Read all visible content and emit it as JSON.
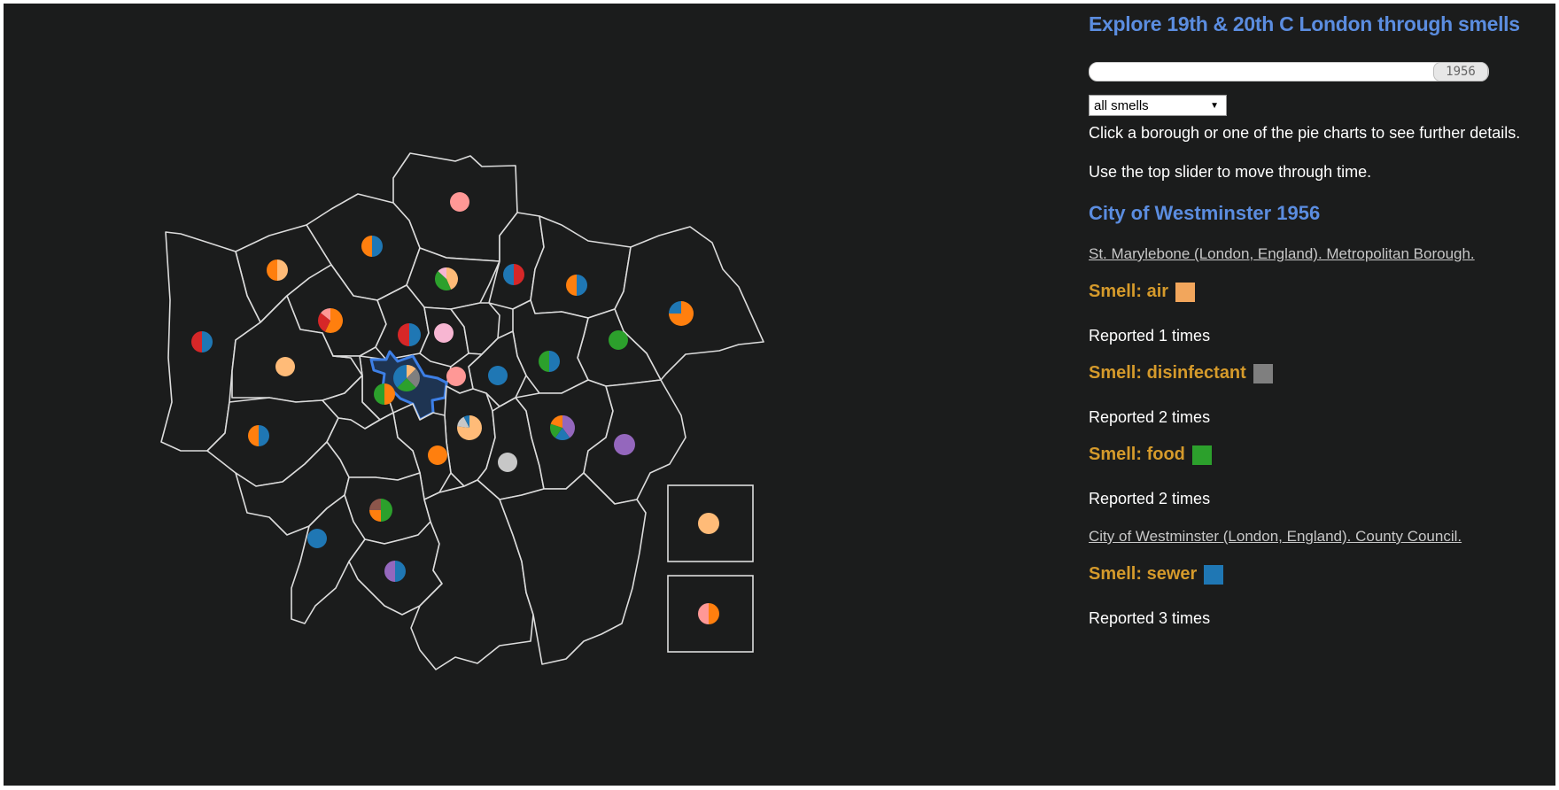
{
  "title": "Explore 19th & 20th C London through smells",
  "slider": {
    "value": "1956",
    "position": 1.0
  },
  "filter": {
    "selected": "all smells"
  },
  "instructions": [
    "Click a borough or one of the pie charts to see further details.",
    "Use the top slider to move through time."
  ],
  "details": {
    "heading": "City of Westminster 1956",
    "sources": [
      {
        "name": "St. Marylebone (London, England). Metropolitan Borough.",
        "smells": [
          {
            "label": "Smell: air",
            "color": "#f2a65c",
            "reported": "Reported 1 times"
          },
          {
            "label": "Smell: disinfectant",
            "color": "#7f7f7f",
            "reported": "Reported 2 times"
          },
          {
            "label": "Smell: food",
            "color": "#2ca02c",
            "reported": "Reported 2 times"
          }
        ]
      },
      {
        "name": "City of Westminster (London, England). County Council.",
        "smells": [
          {
            "label": "Smell: sewer",
            "color": "#1f77b4",
            "reported": "Reported 3 times"
          }
        ]
      }
    ]
  },
  "colors": {
    "blue": "#1f77b4",
    "orange": "#ff7f0e",
    "green": "#2ca02c",
    "red": "#d62728",
    "purple": "#9467bd",
    "brown": "#8c564b",
    "pink": "#f7b6d2",
    "salmon": "#ff9896",
    "peach": "#ffbb78",
    "grey": "#7f7f7f",
    "lightgrey": "#c7c7c7"
  },
  "pies": [
    {
      "id": "enfield",
      "slices": [
        [
          "salmon",
          1
        ]
      ]
    },
    {
      "id": "barnet",
      "slices": [
        [
          "blue",
          1
        ],
        [
          "orange",
          1
        ]
      ]
    },
    {
      "id": "harrow",
      "slices": [
        [
          "peach",
          1
        ],
        [
          "orange",
          1
        ]
      ]
    },
    {
      "id": "haringey",
      "slices": [
        [
          "peach",
          1
        ],
        [
          "green",
          1
        ],
        [
          "pink",
          0.3
        ]
      ]
    },
    {
      "id": "waltham-forest",
      "slices": [
        [
          "red",
          1
        ],
        [
          "blue",
          1
        ]
      ]
    },
    {
      "id": "redbridge",
      "slices": [
        [
          "blue",
          1
        ],
        [
          "orange",
          1
        ]
      ]
    },
    {
      "id": "havering",
      "slices": [
        [
          "orange",
          3
        ],
        [
          "blue",
          1
        ]
      ]
    },
    {
      "id": "brent",
      "slices": [
        [
          "orange",
          2
        ],
        [
          "red",
          1
        ],
        [
          "salmon",
          0.5
        ]
      ]
    },
    {
      "id": "camden",
      "slices": [
        [
          "blue",
          1
        ],
        [
          "red",
          1
        ]
      ]
    },
    {
      "id": "islington",
      "slices": [
        [
          "pink",
          1
        ]
      ]
    },
    {
      "id": "hillingdon",
      "slices": [
        [
          "blue",
          1
        ],
        [
          "red",
          1
        ]
      ]
    },
    {
      "id": "barking",
      "slices": [
        [
          "green",
          1
        ]
      ]
    },
    {
      "id": "ealing",
      "slices": [
        [
          "peach",
          1
        ]
      ]
    },
    {
      "id": "westminster",
      "slices": [
        [
          "peach",
          1
        ],
        [
          "grey",
          2
        ],
        [
          "green",
          2
        ],
        [
          "blue",
          3
        ]
      ]
    },
    {
      "id": "hackney-city",
      "slices": [
        [
          "salmon",
          1
        ]
      ]
    },
    {
      "id": "tower-hamlets",
      "slices": [
        [
          "blue",
          1
        ]
      ]
    },
    {
      "id": "newham",
      "slices": [
        [
          "blue",
          1
        ],
        [
          "green",
          1
        ]
      ]
    },
    {
      "id": "kensington",
      "slices": [
        [
          "orange",
          1
        ],
        [
          "green",
          1
        ]
      ]
    },
    {
      "id": "southwark",
      "slices": [
        [
          "peach",
          5
        ],
        [
          "lightgrey",
          1
        ],
        [
          "blue",
          0.5
        ]
      ]
    },
    {
      "id": "greenwich",
      "slices": [
        [
          "purple",
          2
        ],
        [
          "blue",
          1
        ],
        [
          "green",
          1
        ],
        [
          "orange",
          1
        ]
      ]
    },
    {
      "id": "hounslow",
      "slices": [
        [
          "blue",
          1
        ],
        [
          "orange",
          1
        ]
      ]
    },
    {
      "id": "lambeth",
      "slices": [
        [
          "orange",
          1
        ]
      ]
    },
    {
      "id": "bexley",
      "slices": [
        [
          "purple",
          1
        ]
      ]
    },
    {
      "id": "lewisham",
      "slices": [
        [
          "lightgrey",
          1
        ]
      ]
    },
    {
      "id": "merton",
      "slices": [
        [
          "green",
          2
        ],
        [
          "orange",
          1
        ],
        [
          "brown",
          1
        ]
      ]
    },
    {
      "id": "kingston",
      "slices": [
        [
          "blue",
          1
        ]
      ]
    },
    {
      "id": "sutton",
      "slices": [
        [
          "blue",
          1
        ],
        [
          "purple",
          1
        ]
      ]
    },
    {
      "id": "inset-1",
      "slices": [
        [
          "peach",
          1
        ]
      ]
    },
    {
      "id": "inset-2",
      "slices": [
        [
          "orange",
          1
        ],
        [
          "salmon",
          1
        ]
      ]
    }
  ]
}
